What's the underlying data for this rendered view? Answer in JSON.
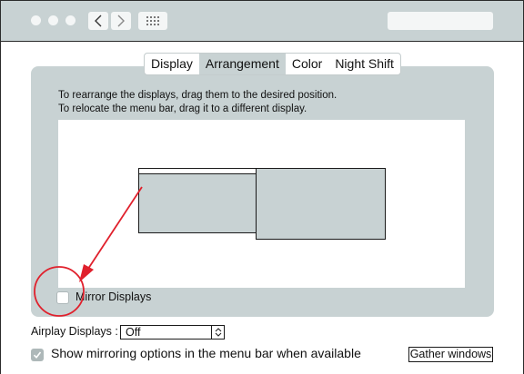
{
  "toolbar": {
    "back_glyph": "<",
    "forward_glyph": ">",
    "grid_icon": "grid-icon",
    "search_placeholder": ""
  },
  "tabs": [
    {
      "label": "Display",
      "active": false
    },
    {
      "label": "Arrangement",
      "active": true
    },
    {
      "label": "Color",
      "active": false
    },
    {
      "label": "Night Shift",
      "active": false
    }
  ],
  "arrangement": {
    "instruction_line1": "To rearrange the displays, drag them to the desired position.",
    "instruction_line2": "To relocate the menu bar, drag it to a different display.",
    "mirror_label": "Mirror Displays",
    "mirror_checked": false
  },
  "airplay": {
    "label": "Airplay Displays :",
    "selected": "Off"
  },
  "mirroring_options": {
    "label": "Show mirroring options in the menu bar when available",
    "checked": true
  },
  "gather_button": "Gather windows",
  "colors": {
    "chrome": "#c8d2d3",
    "annotation": "#e0202c"
  }
}
